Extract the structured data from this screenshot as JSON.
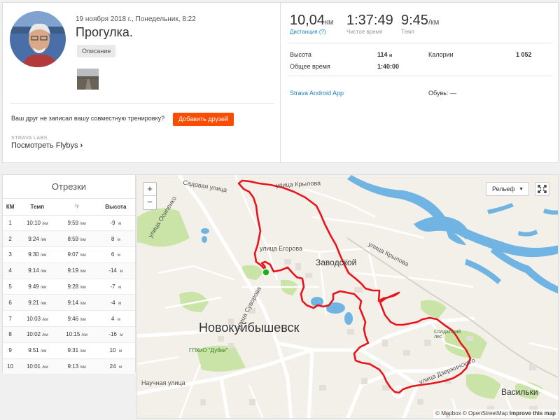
{
  "activity": {
    "date": "19 ноября 2018 г., Понедельник, 8:22",
    "title": "Прогулка.",
    "description_button": "Описание",
    "friend_prompt": "Ваш друг не записал вашу совместную тренировку?",
    "add_friends_button": "Добавить друзей",
    "labs_label": "STRAVA LABS",
    "flyby_link": "Посмотреть Flybys",
    "flyby_chevron": "›"
  },
  "stats": {
    "distance": {
      "value": "10,04",
      "unit": "км",
      "label": "Дистанция (?)"
    },
    "moving_time": {
      "value": "1:37:49",
      "label": "Чистое время"
    },
    "pace": {
      "value": "9:45",
      "unit": "/км",
      "label": "Темп"
    },
    "elevation_label": "Высота",
    "elevation_value": "114",
    "elevation_unit": "м",
    "calories_label": "Калории",
    "calories_value": "1 052",
    "elapsed_label": "Общее время",
    "elapsed_value": "1:40:00",
    "app": "Strava Android App",
    "shoes": "Обувь: —"
  },
  "splits": {
    "title": "Отрезки",
    "headers": {
      "km": "КМ",
      "pace": "Темп",
      "gap": "ту",
      "elev": "Высота"
    },
    "pace_unit": "/км",
    "elev_unit": "м",
    "rows": [
      {
        "km": "1",
        "pace": "10:10",
        "gap": "9:59",
        "elev": "-9"
      },
      {
        "km": "2",
        "pace": "9:24",
        "gap": "8:59",
        "elev": "8"
      },
      {
        "km": "3",
        "pace": "9:30",
        "gap": "9:07",
        "elev": "6"
      },
      {
        "km": "4",
        "pace": "9:14",
        "gap": "9:19",
        "elev": "-14"
      },
      {
        "km": "5",
        "pace": "9:49",
        "gap": "9:28",
        "elev": "-7"
      },
      {
        "km": "6",
        "pace": "9:21",
        "gap": "9:14",
        "elev": "-4"
      },
      {
        "km": "7",
        "pace": "10:03",
        "gap": "9:46",
        "elev": "4"
      },
      {
        "km": "8",
        "pace": "10:02",
        "gap": "10:15",
        "elev": "-16"
      },
      {
        "km": "9",
        "pace": "9:51",
        "gap": "9:31",
        "elev": "10"
      },
      {
        "km": "10",
        "pace": "10:01",
        "gap": "9:13",
        "elev": "24"
      }
    ]
  },
  "map": {
    "zoom_in": "+",
    "zoom_out": "−",
    "terrain_button": "Рельеф",
    "terrain_caret": "▼",
    "labels": {
      "city": "Новокуйбышевск",
      "district": "Заводской",
      "village": "Васильки",
      "park": "ГПКиО \"Дубки\"",
      "forest": "Солдатский лес",
      "street_krylova1": "улица Крылова",
      "street_krylova2": "улица Крылова",
      "street_sadovaya": "Садовая улица",
      "street_osipenko": "улица Осипенко",
      "street_egorova": "улица Егорова",
      "street_suvorova": "улица Суворова",
      "street_dzerzhinskogo": "улица Дзержинского",
      "street_nauchnaya": "Научная улица"
    },
    "attribution_mapbox": "© Mapbox",
    "attribution_osm": "© OpenStreetMap",
    "attribution_improve": "Improve this map"
  },
  "colors": {
    "accent": "#fc4c02",
    "link": "#1f7fbf",
    "route": "#e8141c",
    "water": "#6fb4e3",
    "park": "#c9e4a6",
    "start_marker": "#1ab01a"
  }
}
